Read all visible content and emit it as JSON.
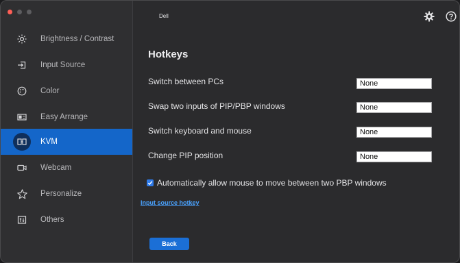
{
  "app": {
    "title": "Dell"
  },
  "sidebar": {
    "items": [
      {
        "label": "Brightness / Contrast",
        "icon": "sun-icon"
      },
      {
        "label": "Input Source",
        "icon": "input-source-icon"
      },
      {
        "label": "Color",
        "icon": "palette-icon"
      },
      {
        "label": "Easy Arrange",
        "icon": "layout-icon"
      },
      {
        "label": "KVM",
        "icon": "kvm-icon",
        "active": true
      },
      {
        "label": "Webcam",
        "icon": "webcam-icon"
      },
      {
        "label": "Personalize",
        "icon": "star-icon"
      },
      {
        "label": "Others",
        "icon": "others-icon"
      }
    ]
  },
  "hotkeys": {
    "heading": "Hotkeys",
    "rows": [
      {
        "label": "Switch between PCs",
        "value": "None"
      },
      {
        "label": "Swap two inputs of PIP/PBP windows",
        "value": "None"
      },
      {
        "label": "Switch keyboard and mouse",
        "value": "None"
      },
      {
        "label": "Change PIP position",
        "value": "None"
      }
    ],
    "auto_mouse_label": "Automatically allow mouse to move between two PBP windows",
    "auto_mouse_checked": true,
    "input_source_link": "Input source hotkey",
    "back_label": "Back"
  },
  "colors": {
    "accent": "#1466c9",
    "link": "#4aa3ff",
    "close": "#ff5f57"
  }
}
